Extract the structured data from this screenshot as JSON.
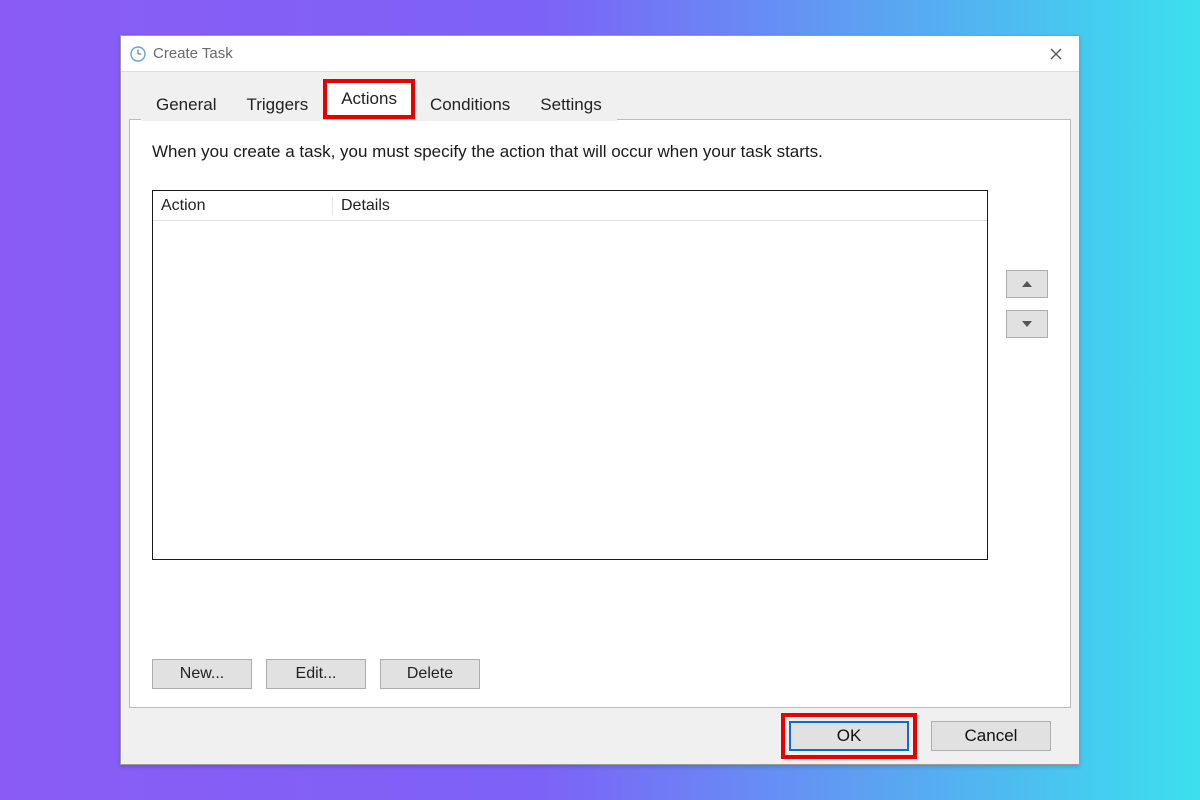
{
  "window": {
    "title": "Create Task"
  },
  "tabs": {
    "general": "General",
    "triggers": "Triggers",
    "actions": "Actions",
    "conditions": "Conditions",
    "settings": "Settings"
  },
  "panel": {
    "explain": "When you create a task, you must specify the action that will occur when your task starts.",
    "col_action": "Action",
    "col_details": "Details",
    "btn_new": "New...",
    "btn_edit": "Edit...",
    "btn_delete": "Delete"
  },
  "footer": {
    "ok": "OK",
    "cancel": "Cancel"
  }
}
